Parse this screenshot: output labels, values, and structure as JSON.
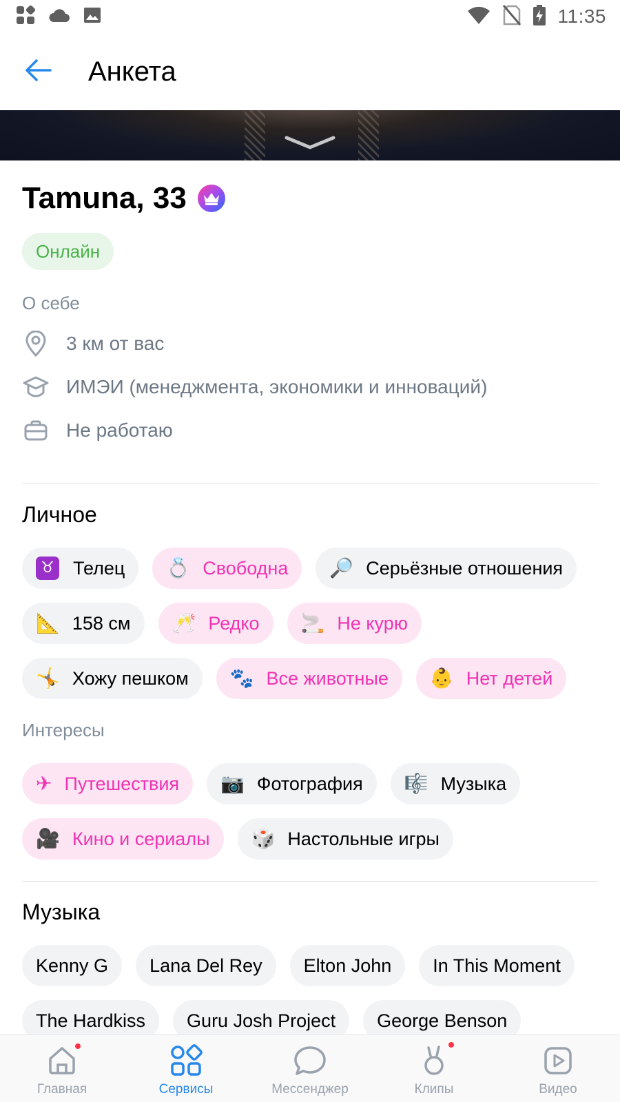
{
  "status_bar": {
    "time": "11:35",
    "left_icons": [
      "app-grid-icon",
      "cloud-icon",
      "image-icon"
    ],
    "right_icons": [
      "wifi-icon",
      "no-sim-icon",
      "battery-charging-icon"
    ]
  },
  "app_bar": {
    "back_icon": "arrow-left-icon",
    "title": "Анкета"
  },
  "profile": {
    "name": "Tamuna, 33",
    "badge_icon": "crown-icon",
    "status": "Онлайн",
    "about_label": "О себе",
    "info": [
      {
        "icon": "location-pin-icon",
        "text": "3 км от вас"
      },
      {
        "icon": "graduation-cap-icon",
        "text": "ИМЭИ (менеджмента, экономики и инноваций)"
      },
      {
        "icon": "briefcase-icon",
        "text": "Не работаю"
      }
    ]
  },
  "personal": {
    "title": "Личное",
    "chips": [
      {
        "emoji": "♉",
        "label": "Телец",
        "highlight": false
      },
      {
        "emoji": "💍",
        "label": "Свободна",
        "highlight": true
      },
      {
        "emoji": "🔎",
        "label": "Серьёзные отношения",
        "highlight": false
      },
      {
        "emoji": "📐",
        "label": "158 см",
        "highlight": false
      },
      {
        "emoji": "🥂",
        "label": "Редко",
        "highlight": true
      },
      {
        "emoji": "🚬",
        "label": "Не курю",
        "highlight": true
      },
      {
        "emoji": "🤸",
        "label": "Хожу пешком",
        "highlight": false
      },
      {
        "emoji": "🐾",
        "label": "Все животные",
        "highlight": true
      },
      {
        "emoji": "👶",
        "label": "Нет детей",
        "highlight": true
      }
    ]
  },
  "interests": {
    "title": "Интересы",
    "chips": [
      {
        "emoji": "✈",
        "label": "Путешествия",
        "highlight": true
      },
      {
        "emoji": "📷",
        "label": "Фотография",
        "highlight": false
      },
      {
        "emoji": "🎼",
        "label": "Музыка",
        "highlight": false
      },
      {
        "emoji": "🎥",
        "label": "Кино и сериалы",
        "highlight": true
      },
      {
        "emoji": "🎲",
        "label": "Настольные игры",
        "highlight": false
      }
    ]
  },
  "music": {
    "title": "Музыка",
    "artists": [
      "Kenny G",
      "Lana Del Rey",
      "Elton John",
      "In This Moment",
      "The Hardkiss",
      "Guru Josh Project",
      "George Benson"
    ]
  },
  "bottom_nav": [
    {
      "icon": "home-icon",
      "label": "Главная",
      "active": false,
      "dot": true
    },
    {
      "icon": "services-icon",
      "label": "Сервисы",
      "active": true,
      "dot": false
    },
    {
      "icon": "messenger-icon",
      "label": "Мессенджер",
      "active": false,
      "dot": false
    },
    {
      "icon": "clips-icon",
      "label": "Клипы",
      "active": false,
      "dot": true
    },
    {
      "icon": "video-icon",
      "label": "Видео",
      "active": false,
      "dot": false
    }
  ],
  "colors": {
    "accent": "#2688eb",
    "pink_chip_text": "#ef33b3",
    "pink_chip_bg": "#fde5f3",
    "online_text": "#4bb34b",
    "online_bg": "#e8f6ea",
    "notification_dot": "#ff3347"
  }
}
